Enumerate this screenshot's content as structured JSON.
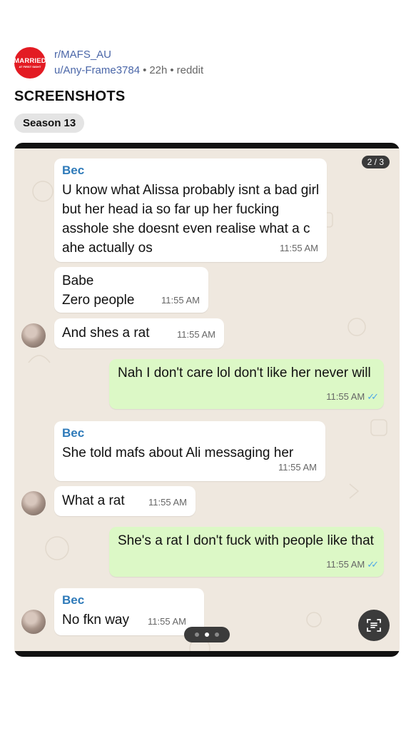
{
  "post": {
    "subreddit": "r/MAFS_AU",
    "user": "u/Any-Frame3784",
    "age": "22h",
    "source": "reddit",
    "flair_title": "SCREENSHOTS",
    "flair": "Season 13",
    "avatar_text_big": "MARRIED",
    "avatar_text_small": "AT FIRST SIGHT"
  },
  "gallery": {
    "counter": "2 / 3",
    "page_index": 2,
    "page_total": 3
  },
  "chat": {
    "m1": {
      "sender": "Bec",
      "text": "U know what Alissa probably isnt a bad girl but her head ia so far up her fucking asshole she doesnt even realise what a c     ahe actually os",
      "time": "11:55 AM"
    },
    "m2": {
      "text": "Babe\nZero people",
      "time": "11:55 AM"
    },
    "m3": {
      "text": "And shes a rat",
      "time": "11:55 AM"
    },
    "m4": {
      "text": "Nah I don't care lol don't like her never will",
      "time": "11:55 AM",
      "ticks": "✓✓"
    },
    "m5": {
      "sender": "Bec",
      "text": "She told mafs about Ali messaging her",
      "time": "11:55 AM"
    },
    "m6": {
      "text": "What a rat",
      "time": "11:55 AM"
    },
    "m7": {
      "text": "She's a rat I don't fuck with people like that",
      "time": "11:55 AM",
      "ticks": "✓✓"
    },
    "m8": {
      "sender": "Bec",
      "text": "No fkn way",
      "time": "11:55 AM"
    }
  },
  "colors": {
    "outgoing": "#dcf8c6",
    "incoming": "#ffffff",
    "sender": "#2e7ab9",
    "ticks": "#4fa7e6",
    "link": "#4a66a8"
  },
  "icons": {
    "scan": "text-scan-icon",
    "ticks": "double-check-icon"
  }
}
